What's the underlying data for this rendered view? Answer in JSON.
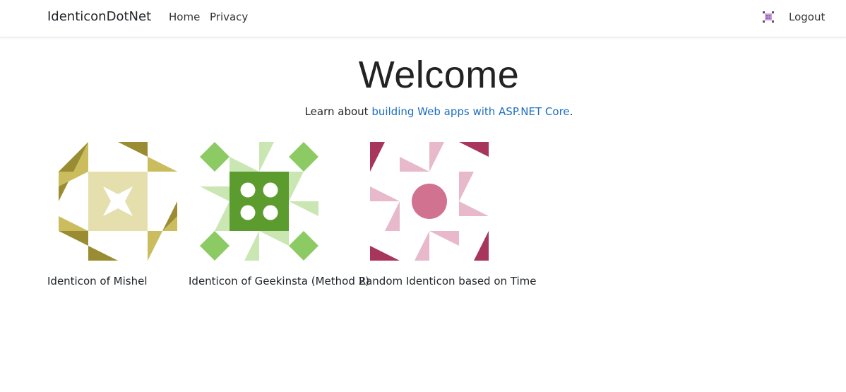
{
  "navbar": {
    "brand": "IdenticonDotNet",
    "links": [
      {
        "label": "Home"
      },
      {
        "label": "Privacy"
      }
    ],
    "logout_label": "Logout",
    "avatar_icon": "identicon-avatar-icon"
  },
  "main": {
    "title": "Welcome",
    "lead_prefix": "Learn about ",
    "lead_link": "building Web apps with ASP.NET Core",
    "lead_suffix": "."
  },
  "identicons": [
    {
      "caption": "Identicon of Mishel",
      "colors": {
        "primary": "#9a8c32",
        "secondary": "#cbbd5e",
        "light": "#e5dfae"
      }
    },
    {
      "caption": "Identicon of Geekinsta (Method 2)",
      "colors": {
        "primary": "#5c9b2e",
        "secondary": "#8ccb63",
        "light": "#c9e6b3"
      }
    },
    {
      "caption": "Random Identicon based on Time",
      "colors": {
        "primary": "#a8355c",
        "secondary": "#d27291",
        "light": "#e7b9cb"
      }
    }
  ],
  "colors": {
    "link": "#1b6ec2",
    "avatar": "#9b59b6"
  }
}
